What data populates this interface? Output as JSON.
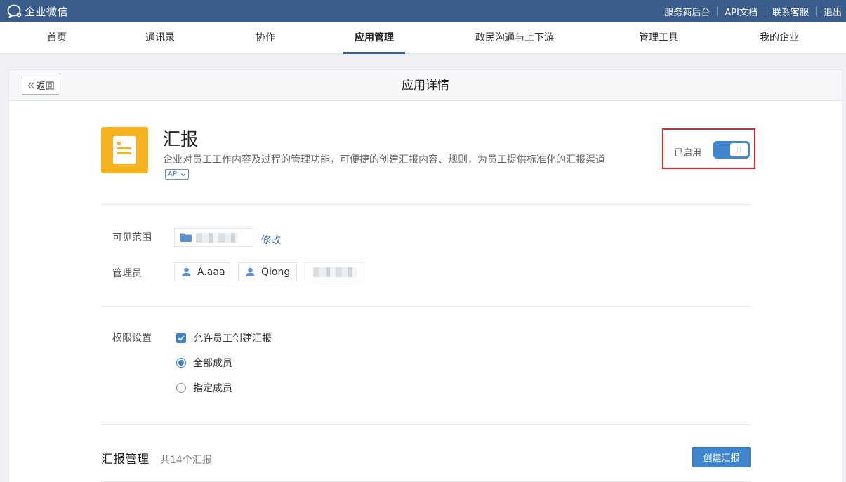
{
  "topbar": {
    "logo_text": "企业微信",
    "links": [
      "服务商后台",
      "API文档",
      "联系客服",
      "退出"
    ]
  },
  "nav": {
    "items": [
      "首页",
      "通讯录",
      "协作",
      "应用管理",
      "政民沟通与上下游",
      "管理工具",
      "我的企业"
    ],
    "active": "应用管理"
  },
  "card": {
    "title": "应用详情",
    "back_label": "返回"
  },
  "app": {
    "name": "汇报",
    "description": "企业对员工工作内容及过程的管理功能，可便捷的创建汇报内容、规则，为员工提供标准化的汇报渠道",
    "api_tag": "API",
    "status_label": "已启用",
    "enabled": true,
    "icon": "document-icon",
    "icon_color": "#f6b31f"
  },
  "visibility": {
    "label": "可见范围",
    "modify_label": "修改"
  },
  "admins": {
    "label": "管理员",
    "people": [
      "A.aaa",
      "Qiong"
    ]
  },
  "permissions": {
    "label": "权限设置",
    "allow_create_label": "允许员工创建汇报",
    "allow_create_checked": true,
    "all_members_label": "全部成员",
    "specified_members_label": "指定成员",
    "selected_option": "全部成员"
  },
  "reports": {
    "title": "汇报管理",
    "count_text": "共14个汇报",
    "create_label": "创建汇报"
  },
  "colors": {
    "topbar": "#3a5c8a",
    "accent": "#3f86cf",
    "highlight_border": "#e02424"
  }
}
